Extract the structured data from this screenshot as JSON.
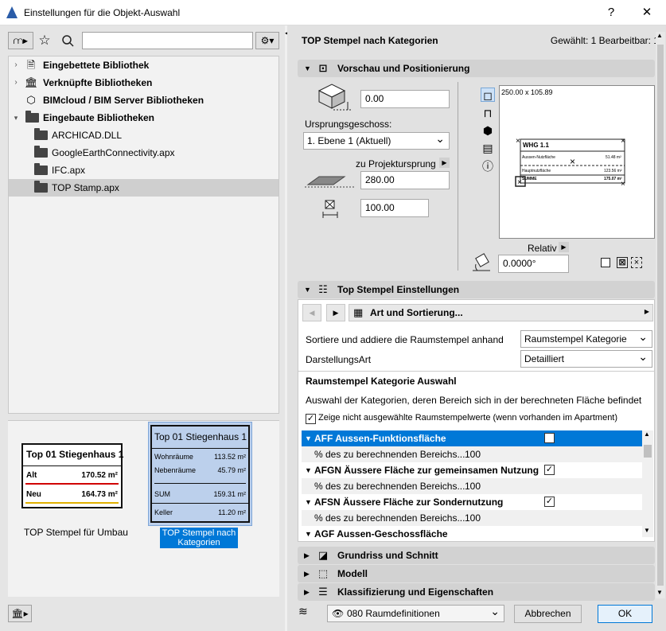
{
  "window": {
    "title": "Einstellungen für die Objekt-Auswahl",
    "help_label": "?",
    "close_label": "✕"
  },
  "library": {
    "items": [
      {
        "label": "Eingebettete Bibliothek",
        "level": 0,
        "bold": true
      },
      {
        "label": "Verknüpfte Bibliotheken",
        "level": 0,
        "bold": true
      },
      {
        "label": "BIMcloud / BIM Server Bibliotheken",
        "level": 0,
        "bold": true
      },
      {
        "label": "Eingebaute Bibliotheken",
        "level": 0,
        "bold": true
      },
      {
        "label": "ARCHICAD.DLL",
        "level": 1
      },
      {
        "label": "GoogleEarthConnectivity.apx",
        "level": 1
      },
      {
        "label": "IFC.apx",
        "level": 1
      },
      {
        "label": "TOP Stamp.apx",
        "level": 1,
        "selected": true
      }
    ]
  },
  "previews": {
    "umbau": {
      "title": "Top 01 Stiegenhaus 1",
      "rows": [
        {
          "label": "Alt",
          "value": "170.52 m²"
        },
        {
          "label": "Neu",
          "value": "164.73 m²"
        }
      ],
      "caption": "TOP Stempel für Umbau"
    },
    "kategorien": {
      "title": "Top 01 Stiegenhaus 1",
      "rows": [
        {
          "label": "Wohnräume",
          "value": "113.52 m²"
        },
        {
          "label": "Nebenräume",
          "value": "45.79 m²"
        },
        {
          "label": "SUM",
          "value": "159.31 m²"
        },
        {
          "label": "Keller",
          "value": "11.20 m²"
        }
      ],
      "caption": "TOP Stempel nach Kategorien"
    }
  },
  "header": {
    "title": "TOP Stempel nach Kategorien",
    "status": "Gewählt: 1 Bearbeitbar: 1"
  },
  "sections": {
    "vorschau": "Vorschau und Positionierung",
    "einstellungen": "Top Stempel Einstellungen",
    "grundriss": "Grundriss und Schnitt",
    "modell": "Modell",
    "klassifizierung": "Klassifizierung und Eigenschaften"
  },
  "positioning": {
    "elevation_value": "0.00",
    "ursprung_label": "Ursprungsgeschoss:",
    "ursprung_value": "1. Ebene 1 (Aktuell)",
    "projekt_label": "zu Projektursprung",
    "projekt_value": "280.00",
    "height_value": "100.00",
    "preview_size": "250.00 x 105.89",
    "relativ_label": "Relativ",
    "angle_value": "0.0000°",
    "preview_text": {
      "title": "WHG 1.1",
      "r1": "Aussen-Nutzfläche",
      "v1": "51.48 m²",
      "r2": "Hauptnutzfläche",
      "v2": "123.56 m²",
      "r3": "SUMME",
      "v3": "175.07 m²"
    }
  },
  "settings": {
    "page_title": "Art und Sortierung...",
    "sort_label": "Sortiere und addiere die Raumstempel anhand",
    "sort_value": "Raumstempel Kategorie",
    "display_label": "DarstellungsArt",
    "display_value": "Detailliert",
    "category_heading": "Raumstempel Kategorie Auswahl",
    "category_desc": "Auswahl der Kategorien, deren Bereich sich in der berechneten Fläche befindet",
    "show_unselected": "Zeige nicht ausgewählte Raumstempelwerte (wenn vorhanden im Apartment)",
    "categories": [
      {
        "label": "AFF Aussen-Funktionsfläche",
        "pct_label": "% des zu berechnenden Bereichs...",
        "pct_value": "100",
        "selected": true
      },
      {
        "label": "AFGN Äussere Fläche zur gemeinsamen Nutzung",
        "pct_label": "% des zu berechnenden Bereichs...",
        "pct_value": "100"
      },
      {
        "label": "AFSN Äussere Fläche zur Sondernutzung",
        "pct_label": "% des zu berechnenden Bereichs...",
        "pct_value": "100"
      },
      {
        "label": "AGF Aussen-Geschossfläche"
      }
    ]
  },
  "footer": {
    "layer": "080 Raumdefinitionen",
    "cancel": "Abbrechen",
    "ok": "OK"
  },
  "colors": {
    "accent": "#0078d7",
    "alt_line": "#d00000",
    "neu_line": "#e0b000"
  }
}
